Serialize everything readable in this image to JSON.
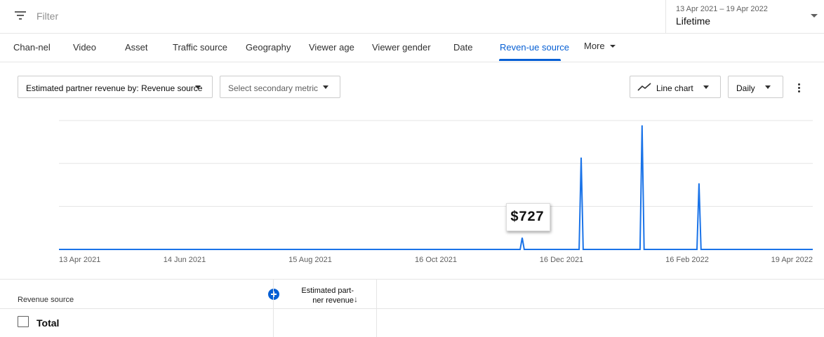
{
  "filter": {
    "icon": "filter-list-icon",
    "placeholder": "Filter"
  },
  "date_range": {
    "range": "13 Apr 2021 – 19 Apr 2022",
    "label": "Lifetime"
  },
  "tabs": [
    {
      "label": "Chan-nel"
    },
    {
      "label": "Video"
    },
    {
      "label": "Asset"
    },
    {
      "label": "Traffic source"
    },
    {
      "label": "Geography"
    },
    {
      "label": "Viewer age"
    },
    {
      "label": "Viewer gender"
    },
    {
      "label": "Date"
    },
    {
      "label": "Reven-ue source",
      "active": true
    },
    {
      "label": "More"
    }
  ],
  "controls": {
    "metric": "Estimated partner revenue by: Revenue source",
    "secondary": "Select secondary metric",
    "chart_type": "Line chart",
    "chart_type_icon": "line-chart-icon",
    "period": "Daily",
    "more_icon": "more-vert-icon"
  },
  "chart_data": {
    "type": "line",
    "x_ticks": [
      "13 Apr 2021",
      "14 Jun 2021",
      "15 Aug 2021",
      "16 Oct 2021",
      "16 Dec 2021",
      "16 Feb 2022",
      "19 Apr 2022"
    ],
    "series": [
      {
        "color": "#1a73e8",
        "points": [
          {
            "x": "2021-04-13",
            "y": 0
          },
          {
            "x": "2021-11-26",
            "y": 0
          },
          {
            "x": "2021-11-27",
            "y": 727
          },
          {
            "x": "2021-11-28",
            "y": 0
          },
          {
            "x": "2021-12-25",
            "y": 0
          },
          {
            "x": "2021-12-26",
            "y": 5700
          },
          {
            "x": "2021-12-27",
            "y": 0
          },
          {
            "x": "2022-01-24",
            "y": 0
          },
          {
            "x": "2022-01-25",
            "y": 7700
          },
          {
            "x": "2022-01-26",
            "y": 0
          },
          {
            "x": "2022-02-21",
            "y": 0
          },
          {
            "x": "2022-02-22",
            "y": 4100
          },
          {
            "x": "2022-02-23",
            "y": 0
          },
          {
            "x": "2022-04-19",
            "y": 0
          }
        ]
      }
    ],
    "ylim": [
      0,
      8000
    ],
    "grid": true,
    "callout": "$727"
  },
  "table": {
    "col_revenue_source": "Revenue source",
    "col_revenue_line1": "Estimated part-",
    "col_revenue_line2": "ner revenue",
    "sort_icon": "arrow-down-icon",
    "add_icon": "add-circle-icon",
    "total_label": "Total"
  }
}
